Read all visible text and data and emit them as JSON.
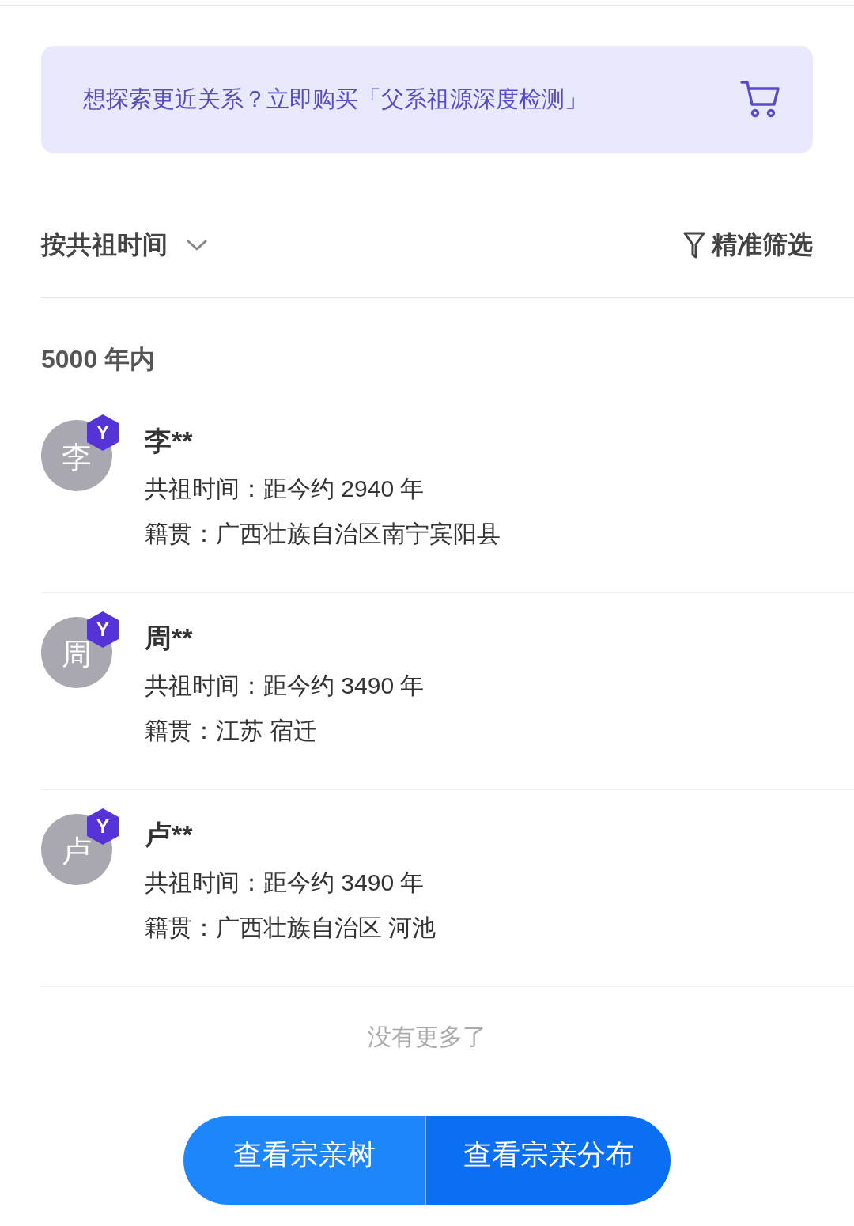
{
  "promo": {
    "text": "想探索更近关系？立即购买「父系祖源深度检测」"
  },
  "sort": {
    "label": "按共祖时间",
    "filter": "精准筛选"
  },
  "section": {
    "title": "5000 年内"
  },
  "members": [
    {
      "avatar": "李",
      "badge": "Y",
      "name": "李**",
      "time": "共祖时间：距今约 2940 年",
      "origin": "籍贯：广西壮族自治区南宁宾阳县"
    },
    {
      "avatar": "周",
      "badge": "Y",
      "name": "周**",
      "time": "共祖时间：距今约 3490 年",
      "origin": "籍贯：江苏 宿迁"
    },
    {
      "avatar": "卢",
      "badge": "Y",
      "name": "卢**",
      "time": "共祖时间：距今约 3490 年",
      "origin": "籍贯：广西壮族自治区 河池"
    }
  ],
  "end_note": "没有更多了",
  "buttons": [
    {
      "label": "查看宗亲树"
    },
    {
      "label": "查看宗亲分布"
    }
  ]
}
